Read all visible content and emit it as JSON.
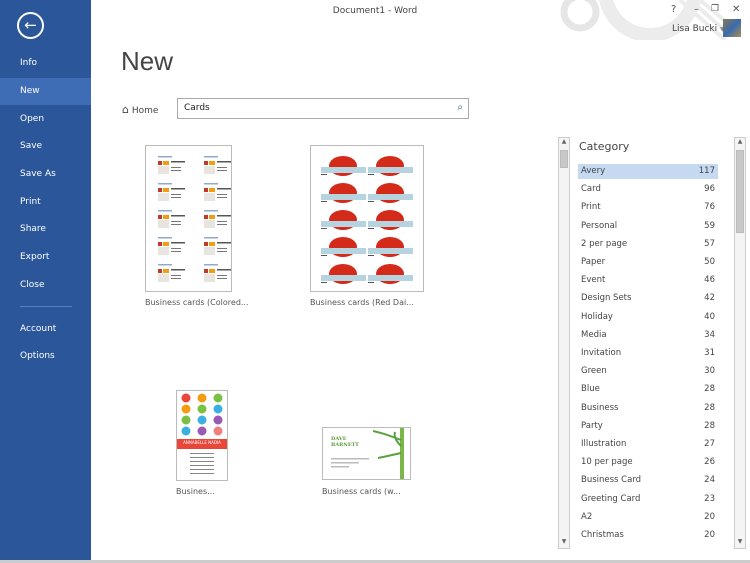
{
  "window": {
    "title": "Document1 - Word",
    "help": "?",
    "minimize": "–",
    "restore": "❐",
    "close": "✕",
    "user": "Lisa Bucki"
  },
  "sidebar": {
    "items": [
      {
        "label": "Info"
      },
      {
        "label": "New",
        "selected": true
      },
      {
        "label": "Open"
      },
      {
        "label": "Save"
      },
      {
        "label": "Save As"
      },
      {
        "label": "Print"
      },
      {
        "label": "Share"
      },
      {
        "label": "Export"
      },
      {
        "label": "Close"
      },
      {
        "label": "Account"
      },
      {
        "label": "Options"
      }
    ]
  },
  "main": {
    "title": "New",
    "home_label": "Home",
    "search_value": "Cards",
    "templates": [
      {
        "caption": "Business cards (Colored..."
      },
      {
        "caption": "Business cards (Red Dai..."
      },
      {
        "caption": "Busines...",
        "name_text": "ANNABELLE NADIA"
      },
      {
        "caption": "Business cards (w...",
        "name_text": "DAVE BARNETT"
      }
    ]
  },
  "category": {
    "title": "Category",
    "items": [
      {
        "label": "Avery",
        "count": "117",
        "selected": true
      },
      {
        "label": "Card",
        "count": "96"
      },
      {
        "label": "Print",
        "count": "76"
      },
      {
        "label": "Personal",
        "count": "59"
      },
      {
        "label": "2 per page",
        "count": "57"
      },
      {
        "label": "Paper",
        "count": "50"
      },
      {
        "label": "Event",
        "count": "46"
      },
      {
        "label": "Design Sets",
        "count": "42"
      },
      {
        "label": "Holiday",
        "count": "40"
      },
      {
        "label": "Media",
        "count": "34"
      },
      {
        "label": "Invitation",
        "count": "31"
      },
      {
        "label": "Green",
        "count": "30"
      },
      {
        "label": "Blue",
        "count": "28"
      },
      {
        "label": "Business",
        "count": "28"
      },
      {
        "label": "Party",
        "count": "28"
      },
      {
        "label": "Illustration",
        "count": "27"
      },
      {
        "label": "10 per page",
        "count": "26"
      },
      {
        "label": "Business Card",
        "count": "24"
      },
      {
        "label": "Greeting Card",
        "count": "23"
      },
      {
        "label": "A2",
        "count": "20"
      },
      {
        "label": "Christmas",
        "count": "20"
      }
    ]
  },
  "colors": {
    "accent": "#2b579a",
    "selected_nav": "#3e6db5",
    "selected_category": "#c5d9f1"
  }
}
